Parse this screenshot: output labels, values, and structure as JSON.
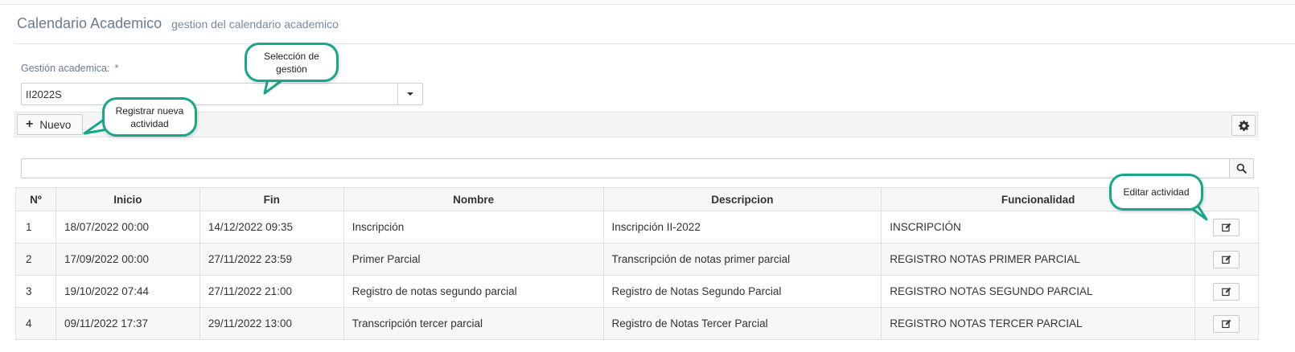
{
  "header": {
    "title": "Calendario Academico",
    "subtitle": "gestion del calendario academico"
  },
  "form": {
    "gestion_label": "Gestión academica:",
    "required_mark": "*",
    "gestion_value": "II2022S"
  },
  "toolbar": {
    "new_label": "Nuevo"
  },
  "search": {
    "value": "",
    "placeholder": ""
  },
  "table": {
    "headers": [
      "Nº",
      "Inicio",
      "Fin",
      "Nombre",
      "Descripcion",
      "Funcionalidad",
      ""
    ],
    "rows": [
      {
        "n": "1",
        "inicio": "18/07/2022 00:00",
        "fin": "14/12/2022 09:35",
        "nombre": "Inscripción",
        "descripcion": "Inscripción II-2022",
        "funcionalidad": "INSCRIPCIÓN"
      },
      {
        "n": "2",
        "inicio": "17/09/2022 00:00",
        "fin": "27/11/2022 23:59",
        "nombre": "Primer Parcial",
        "descripcion": "Transcripción de notas primer parcial",
        "funcionalidad": "REGISTRO NOTAS PRIMER PARCIAL"
      },
      {
        "n": "3",
        "inicio": "19/10/2022 07:44",
        "fin": "27/11/2022 21:00",
        "nombre": "Registro de notas segundo parcial",
        "descripcion": "Registro de Notas Segundo Parcial",
        "funcionalidad": "REGISTRO NOTAS SEGUNDO PARCIAL"
      },
      {
        "n": "4",
        "inicio": "09/11/2022 17:37",
        "fin": "29/11/2022 13:00",
        "nombre": "Transcripción tercer parcial",
        "descripcion": "Registro de Notas Tercer Parcial",
        "funcionalidad": "REGISTRO NOTAS TERCER PARCIAL"
      }
    ]
  },
  "callouts": {
    "seleccion": "Selección de gestión",
    "registrar": "Registrar nueva actividad",
    "editar": "Editar actividad"
  },
  "icons": {
    "new": "plus-icon",
    "settings": "gear-icon",
    "search": "search-icon",
    "edit": "edit-icon",
    "dropdown": "caret-down-icon"
  },
  "colors": {
    "callout_border": "#17a88a",
    "title": "#6b7c8f"
  }
}
